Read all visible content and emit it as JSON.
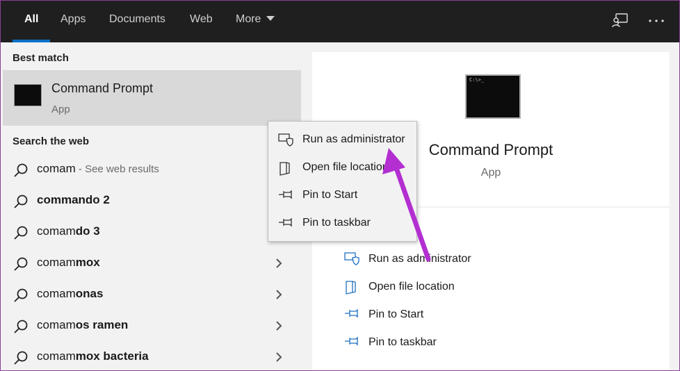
{
  "topbar": {
    "tabs": [
      {
        "label": "All",
        "active": true
      },
      {
        "label": "Apps",
        "active": false
      },
      {
        "label": "Documents",
        "active": false
      },
      {
        "label": "Web",
        "active": false
      },
      {
        "label": "More",
        "active": false
      }
    ],
    "icons": [
      "feedback-icon",
      "more-options-icon"
    ]
  },
  "left": {
    "best_match_heading": "Best match",
    "best_match": {
      "title": "Command Prompt",
      "subtitle": "App"
    },
    "search_web_heading": "Search the web",
    "results": [
      {
        "plain": "comam",
        "bold": "",
        "hint": " - See web results",
        "chevron": false
      },
      {
        "plain": "",
        "bold": "commando 2",
        "hint": "",
        "chevron": false
      },
      {
        "plain": "comam",
        "bold": "do 3",
        "hint": "",
        "chevron": false
      },
      {
        "plain": "comam",
        "bold": "mox",
        "hint": "",
        "chevron": true
      },
      {
        "plain": "comam",
        "bold": "onas",
        "hint": "",
        "chevron": true
      },
      {
        "plain": "comam",
        "bold": "os ramen",
        "hint": "",
        "chevron": true
      },
      {
        "plain": "comam",
        "bold": "mox bacteria",
        "hint": "",
        "chevron": true
      }
    ]
  },
  "preview": {
    "title": "Command Prompt",
    "subtitle": "App",
    "actions": [
      {
        "label": "Run as administrator",
        "icon": "shield-icon"
      },
      {
        "label": "Open file location",
        "icon": "file-location-icon"
      },
      {
        "label": "Pin to Start",
        "icon": "pin-icon"
      },
      {
        "label": "Pin to taskbar",
        "icon": "pin-icon"
      }
    ]
  },
  "context_menu": {
    "items": [
      {
        "label": "Run as administrator",
        "icon": "shield-icon"
      },
      {
        "label": "Open file location",
        "icon": "file-location-icon"
      },
      {
        "label": "Pin to Start",
        "icon": "pin-icon"
      },
      {
        "label": "Pin to taskbar",
        "icon": "pin-icon"
      }
    ]
  },
  "colors": {
    "topbar_bg": "#1f1f1f",
    "accent": "#0b6fc7",
    "pane_bg": "#f2f2f2",
    "selected_bg": "#d9d9d9",
    "annotation_arrow": "#b32fd1",
    "frame_border": "#8a3f9a"
  }
}
